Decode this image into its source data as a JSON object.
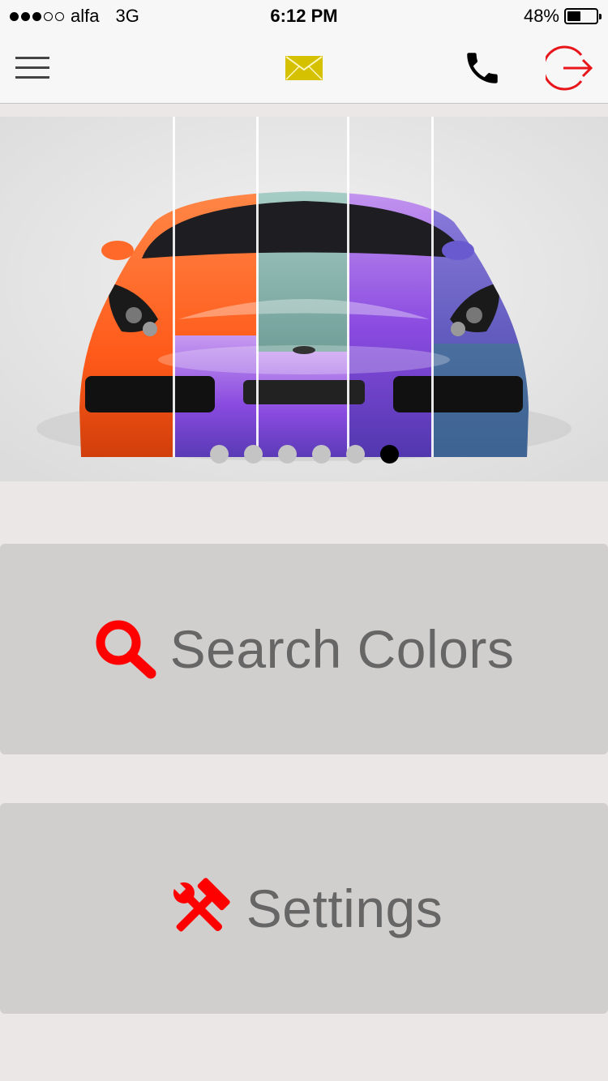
{
  "status_bar": {
    "signal_dots_filled": 3,
    "signal_dots_total": 5,
    "carrier": "alfa",
    "network": "3G",
    "time": "6:12 PM",
    "battery_percent": "48%",
    "battery_level": 0.48
  },
  "nav": {
    "menu_icon": "hamburger-icon",
    "mail_icon": "envelope-icon",
    "phone_icon": "phone-icon",
    "logout_icon": "logout-icon",
    "mail_color": "#d6c100",
    "logout_color": "#e8161b"
  },
  "carousel": {
    "image": "sports car color comparison",
    "page_count": 6,
    "active_page": 5
  },
  "actions": {
    "search": {
      "label": "Search Colors",
      "icon": "search-icon"
    },
    "settings": {
      "label": "Settings",
      "icon": "tools-icon"
    }
  },
  "colors": {
    "accent": "#ff0000",
    "card_bg": "#d1cfce",
    "page_bg": "#ebe7e6",
    "label_text": "#666666"
  }
}
